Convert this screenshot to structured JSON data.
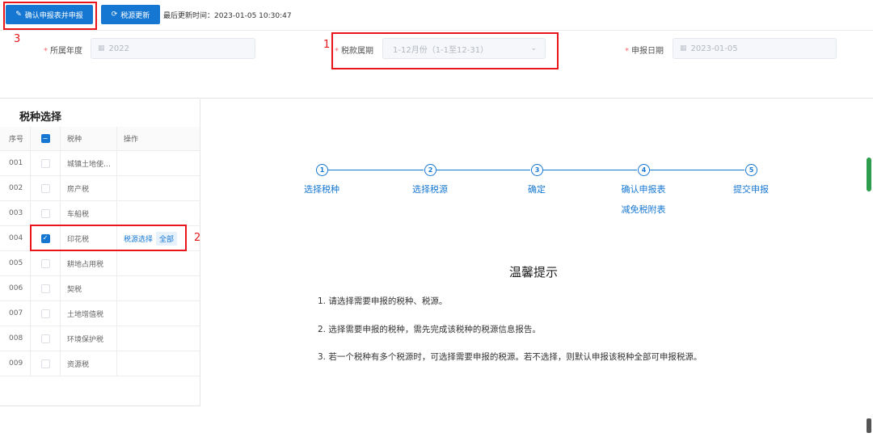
{
  "toolbar": {
    "confirm_label": "确认申报表并申报",
    "refresh_label": "税源更新",
    "last_update": "最后更新时间：2023-01-05 10:30:47"
  },
  "form": {
    "year_label": "所属年度",
    "year_value": "2022",
    "period_label": "税款属期",
    "period_value": "1-12月份（1-1至12-31）",
    "date_label": "申报日期",
    "date_value": "2023-01-05"
  },
  "left_panel": {
    "title": "税种选择",
    "headers": {
      "seq": "序号",
      "tax": "税种",
      "op": "操作"
    },
    "rows": [
      {
        "seq": "001",
        "tax": "城镇土地使…",
        "checked": false
      },
      {
        "seq": "002",
        "tax": "房产税",
        "checked": false
      },
      {
        "seq": "003",
        "tax": "车船税",
        "checked": false
      },
      {
        "seq": "004",
        "tax": "印花税",
        "checked": true,
        "op_link": "税源选择",
        "op_tag": "全部"
      },
      {
        "seq": "005",
        "tax": "耕地占用税",
        "checked": false
      },
      {
        "seq": "006",
        "tax": "契税",
        "checked": false
      },
      {
        "seq": "007",
        "tax": "土地增值税",
        "checked": false
      },
      {
        "seq": "008",
        "tax": "环境保护税",
        "checked": false
      },
      {
        "seq": "009",
        "tax": "资源税",
        "checked": false
      }
    ]
  },
  "steps": [
    {
      "num": "1",
      "label": "选择税种"
    },
    {
      "num": "2",
      "label": "选择税源"
    },
    {
      "num": "3",
      "label": "确定"
    },
    {
      "num": "4",
      "label": "确认申报表",
      "sub": "减免税附表"
    },
    {
      "num": "5",
      "label": "提交申报"
    }
  ],
  "tips": {
    "title": "温馨提示",
    "items": [
      "1. 请选择需要申报的税种、税源。",
      "2. 选择需要申报的税种，需先完成该税种的税源信息报告。",
      "3. 若一个税种有多个税源时，可选择需要申报的税源。若不选择，则默认申报该税种全部可申报税源。"
    ]
  },
  "annotations": [
    "1",
    "2",
    "3"
  ],
  "colors": {
    "primary": "#1677d2",
    "annotation": "#e8151b",
    "required": "#f56c6c"
  }
}
